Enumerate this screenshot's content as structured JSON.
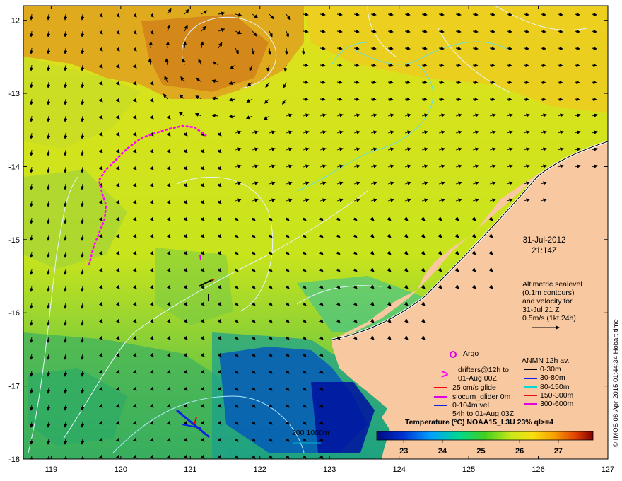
{
  "map": {
    "x_axis_ticks": [
      "119",
      "120",
      "121",
      "122",
      "123",
      "124",
      "125",
      "126",
      "127"
    ],
    "y_axis_ticks": [
      "-12",
      "-13",
      "-14",
      "-15",
      "-16",
      "-17",
      "-18"
    ],
    "lon_range": [
      118.6,
      127.0
    ],
    "lat_range": [
      -18.0,
      -11.8
    ]
  },
  "timestamp": {
    "date": "31-Jul-2012",
    "time": "21:14Z"
  },
  "altimetry_note": {
    "line1": "Altimetric sealevel",
    "line2": "(0.1m contours)",
    "line3": "and velocity for",
    "line4": "31-Jul 21 Z",
    "line5": "0.5m/s (1kt 24h)"
  },
  "legend_left": {
    "argo": "Argo",
    "drifters_line1": "drifters@12h to",
    "drifters_line2": "01-Aug 00Z",
    "glide": "25 cm/s glide",
    "slocum": "slocum_glider 0m",
    "vel_line1": "0-104m vel",
    "vel_line2": "54h to 01-Aug 03Z",
    "depth_scale": "200  1000m"
  },
  "legend_right": {
    "title": "ANMN 12h av.",
    "items": [
      {
        "label": "0-30m",
        "color": "#000000"
      },
      {
        "label": "30-80m",
        "color": "#1020e0"
      },
      {
        "label": "80-150m",
        "color": "#00d8d8"
      },
      {
        "label": "150-300m",
        "color": "#e01010"
      },
      {
        "label": "300-600m",
        "color": "#e000e0"
      }
    ]
  },
  "colorbar": {
    "title": "Temperature (°C) NOAA15_L3U 23% ql>=4",
    "ticks": [
      "23",
      "24",
      "25",
      "26",
      "27"
    ],
    "range": [
      22.3,
      27.9
    ]
  },
  "credit": "© IMOS 08-Apr-2015 01:44:34 Hobart time",
  "colors": {
    "land": "#f8c8a0",
    "argo": "#e000e0",
    "drifters": "#ff00ff",
    "glide": "#ff0000",
    "slocum": "#e000e0",
    "vel": "#1020e0"
  }
}
